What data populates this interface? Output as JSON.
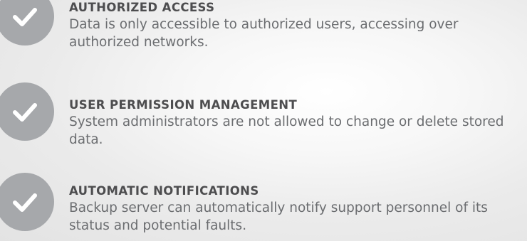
{
  "features": [
    {
      "icon": "check-circle-icon",
      "title": "AUTHORIZED ACCESS",
      "description": "Data is only accessible to authorized users, accessing over authorized networks."
    },
    {
      "icon": "check-circle-icon",
      "title": "USER PERMISSION MANAGEMENT",
      "description": "System administrators are not allowed to change or delete stored data."
    },
    {
      "icon": "check-circle-icon",
      "title": "AUTOMATIC NOTIFICATIONS",
      "description": "Backup server can automatically notify support personnel of its status and potential faults."
    }
  ],
  "colors": {
    "icon_circle": "#a6a8ab",
    "check_mark": "#ffffff",
    "title_text": "#4d4d4f",
    "description_text": "#6b6d70"
  }
}
